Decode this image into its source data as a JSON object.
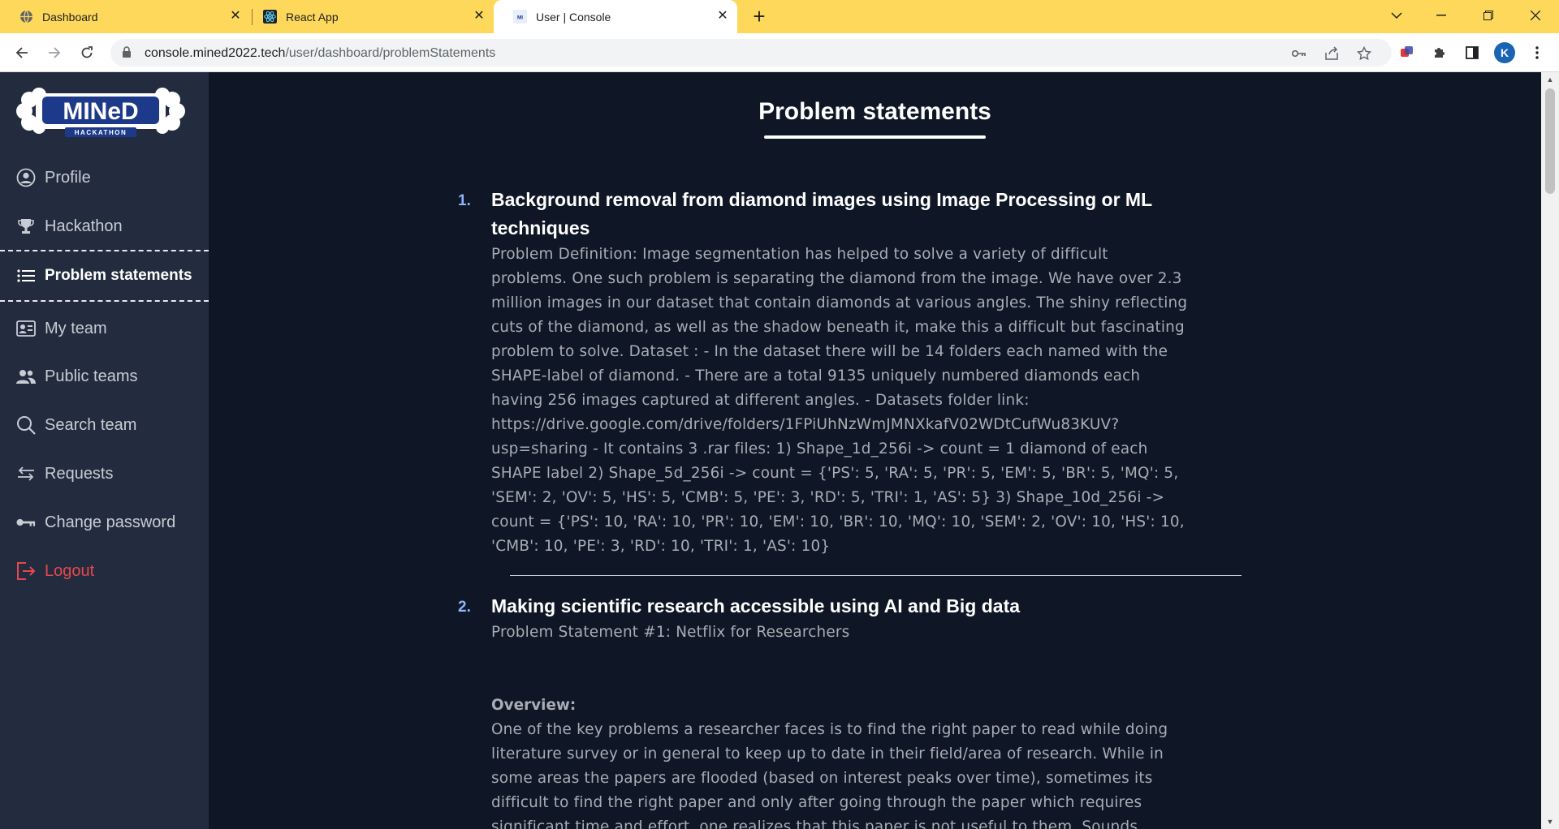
{
  "browser": {
    "tabs": [
      {
        "title": "Dashboard",
        "icon": "globe-icon",
        "active": false
      },
      {
        "title": "React App",
        "icon": "react-icon",
        "active": false
      },
      {
        "title": "User | Console",
        "icon": "mined-favicon",
        "active": true
      }
    ],
    "url_host": "console.mined2022.tech",
    "url_path": "/user/dashboard/problemStatements",
    "avatar_letter": "K"
  },
  "sidebar": {
    "logo_text": "MINeD",
    "logo_subtext": "HACKATHON",
    "items": [
      {
        "label": "Profile",
        "icon": "user-circle-icon"
      },
      {
        "label": "Hackathon",
        "icon": "trophy-icon"
      },
      {
        "label": "Problem statements",
        "icon": "list-icon",
        "active": true
      },
      {
        "label": "My team",
        "icon": "team-card-icon"
      },
      {
        "label": "Public teams",
        "icon": "people-icon"
      },
      {
        "label": "Search team",
        "icon": "search-icon"
      },
      {
        "label": "Requests",
        "icon": "arrows-exchange-icon"
      },
      {
        "label": "Change password",
        "icon": "key-icon"
      },
      {
        "label": "Logout",
        "icon": "logout-icon"
      }
    ]
  },
  "main": {
    "title": "Problem statements",
    "problems": [
      {
        "number": "1.",
        "title": "Background removal from diamond images using Image Processing or ML techniques",
        "body_lines": [
          "Problem Definition: Image segmentation has helped to solve a variety of difficult",
          "problems. One such problem is separating the diamond from the image. We have over 2.3",
          "million images in our dataset that contain diamonds at various angles. The shiny reflecting",
          "cuts of the diamond, as well as the shadow beneath it, make this a difficult but fascinating",
          "problem to solve. Dataset : - In the dataset there will be 14 folders each named with the",
          "SHAPE-label of diamond. - There are a total 9135 uniquely numbered diamonds each",
          "having 256 images captured at different angles. - Datasets folder link:",
          "https://drive.google.com/drive/folders/1FPiUhNzWmJMNXkafV02WDtCufWu83KUV?",
          "usp=sharing - It contains 3 .rar files: 1) Shape_1d_256i -> count = 1 diamond of each",
          "SHAPE label 2) Shape_5d_256i -> count = {'PS': 5, 'RA': 5, 'PR': 5, 'EM': 5, 'BR': 5, 'MQ': 5,",
          "'SEM': 2, 'OV': 5, 'HS': 5, 'CMB': 5, 'PE': 3, 'RD': 5, 'TRI': 1, 'AS': 5} 3) Shape_10d_256i ->",
          "count = {'PS': 10, 'RA': 10, 'PR': 10, 'EM': 10, 'BR': 10, 'MQ': 10, 'SEM': 2, 'OV': 10, 'HS': 10,",
          "'CMB': 10, 'PE': 3, 'RD': 10, 'TRI': 1, 'AS': 10}"
        ]
      },
      {
        "number": "2.",
        "title": "Making scientific research accessible using AI and Big data",
        "subtitle": "Problem Statement #1: Netflix for Researchers",
        "section_heading": "Overview:",
        "body_lines": [
          "One of the key problems a researcher faces is to find the right paper to read while doing",
          "literature survey or in general to keep up to date in their field/area of research. While in",
          "some areas the papers are flooded (based on interest peaks over time), sometimes its",
          "difficult to find the right paper and only after going through the paper which requires",
          "significant time and effort, one realizes that this paper is not useful to them. Sounds"
        ]
      }
    ]
  }
}
